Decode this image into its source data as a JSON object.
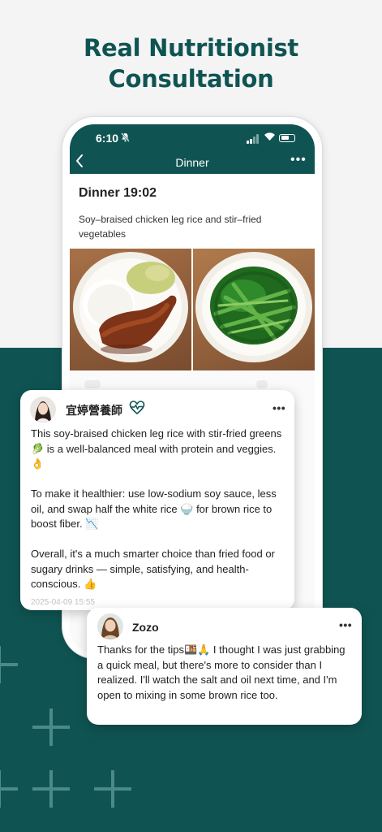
{
  "headline": {
    "line1": "Real Nutritionist",
    "line2": "Consultation"
  },
  "colors": {
    "brand": "#0f5452",
    "background_top": "#f4f4f4",
    "pattern": "#4b8a86"
  },
  "status_bar": {
    "time": "6:10",
    "icons": [
      "bell-muted-icon",
      "signal-icon",
      "wifi-icon",
      "battery-icon"
    ]
  },
  "nav": {
    "title": "Dinner",
    "back_icon": "chevron-left-icon",
    "more_icon": "more-icon"
  },
  "entry": {
    "title": "Dinner 19:02",
    "description": "Soy–braised chicken leg rice and stir–fried vegetables",
    "photos": [
      "soy-braised-chicken-rice-photo",
      "stir-fried-greens-photo"
    ]
  },
  "nutritionist_card": {
    "name": "宜婷營養師",
    "badge_icon": "heart-pulse-icon",
    "paragraphs": [
      "This soy-braised chicken leg rice with stir-fried greens 🥬 is a well-balanced meal with protein and veggies. 👌",
      "To make it healthier: use low-sodium soy sauce, less oil, and swap half the white rice 🍚 for brown rice to boost fiber. 📉",
      "Overall, it's a much smarter choice than fried food or sugary drinks — simple, satisfying, and health-conscious. 👍"
    ],
    "timestamp": "2025-04-09 15:55"
  },
  "user_card": {
    "name": "Zozo",
    "message": "Thanks for the tips🍱🙏 I thought I was just grabbing a quick meal, but there's more to consider than I realized. I'll watch the salt and oil next time, and I'm open to mixing in some brown rice too."
  }
}
